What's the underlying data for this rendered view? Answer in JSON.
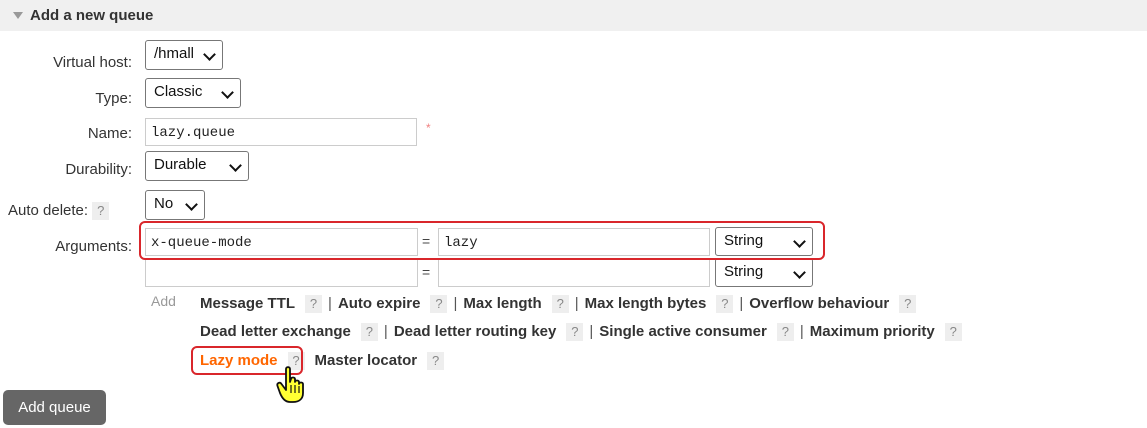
{
  "section": {
    "title": "Add a new queue"
  },
  "form": {
    "virtual_host": {
      "label": "Virtual host:",
      "value": "/hmall"
    },
    "type": {
      "label": "Type:",
      "value": "Classic"
    },
    "name": {
      "label": "Name:",
      "value": "lazy.queue",
      "required_mark": "*"
    },
    "durability": {
      "label": "Durability:",
      "value": "Durable"
    },
    "auto_delete": {
      "label": "Auto delete:",
      "help": "?",
      "value": "No"
    },
    "arguments": {
      "label": "Arguments:",
      "rows": [
        {
          "key": "x-queue-mode",
          "eq": "=",
          "value": "lazy",
          "type": "String"
        },
        {
          "key": "",
          "eq": "=",
          "value": "",
          "type": "String"
        }
      ]
    }
  },
  "add_shortcuts": {
    "add_label": "Add",
    "help": "?",
    "separator": "|",
    "line1": [
      "Message TTL",
      "Auto expire",
      "Max length",
      "Max length bytes",
      "Overflow behaviour"
    ],
    "line2": [
      "Dead letter exchange",
      "Dead letter routing key",
      "Single active consumer",
      "Maximum priority"
    ],
    "line3": [
      "Lazy mode",
      "Master locator"
    ]
  },
  "buttons": {
    "add_queue": "Add queue"
  },
  "colors": {
    "highlight_red": "#d9262b",
    "lazy_orange": "#ff6600",
    "button_bg": "#666666"
  }
}
